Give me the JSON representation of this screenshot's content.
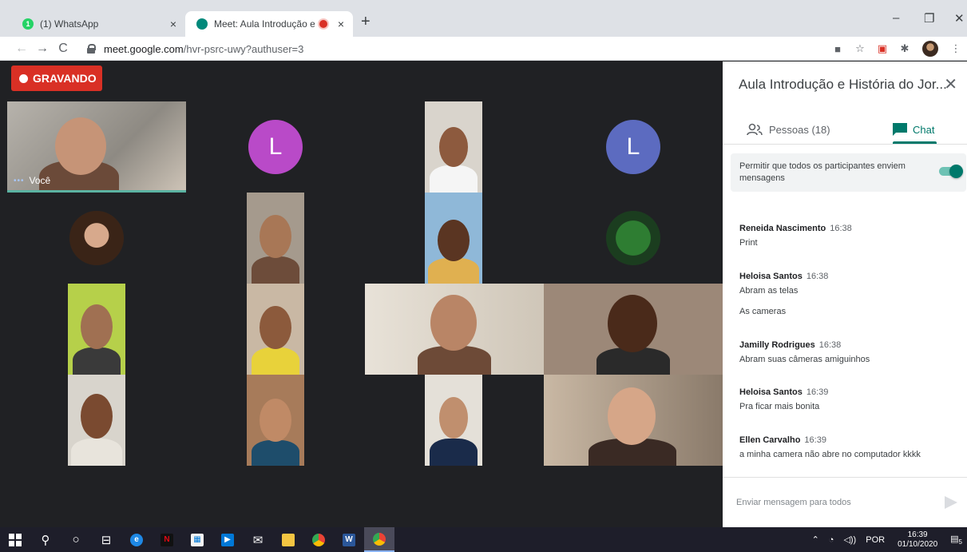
{
  "browser": {
    "tabs": [
      {
        "title": "(1) WhatsApp",
        "favicon": "whatsapp-icon",
        "favicon_color": "#25d366",
        "active": false
      },
      {
        "title": "Meet: Aula Introdução e Hist",
        "favicon": "meet-icon",
        "favicon_color": "#00897b",
        "active": true
      }
    ],
    "new_tab": "+",
    "close_glyph": "×",
    "window_controls": {
      "minimize": "–",
      "restore": "❐",
      "close": "✕"
    },
    "url_host": "meet.google.com",
    "url_path": "/hvr-psrc-uwy?authuser=3"
  },
  "meet": {
    "recording_label": "GRAVANDO",
    "self_label": "Você",
    "avatar_letters": [
      "L",
      "L"
    ],
    "avatar_colors": [
      "#b94ac8",
      "#5c6bc0"
    ]
  },
  "panel": {
    "title": "Aula Introdução e História do Jor...",
    "close": "✕",
    "tab_people": "Pessoas (18)",
    "tab_chat": "Chat",
    "allow_text": "Permitir que todos os participantes enviem mensagens",
    "toggle_on": true,
    "messages": [
      {
        "sender": "Reneida Nascimento",
        "time": "16:38",
        "lines": [
          "Print"
        ]
      },
      {
        "sender": "Heloisa Santos",
        "time": "16:38",
        "lines": [
          "Abram as telas",
          "As cameras"
        ]
      },
      {
        "sender": "Jamilly Rodrigues",
        "time": "16:38",
        "lines": [
          "Abram suas câmeras amiguinhos"
        ]
      },
      {
        "sender": "Heloisa Santos",
        "time": "16:39",
        "lines": [
          "Pra ficar mais bonita"
        ]
      },
      {
        "sender": "Ellen Carvalho",
        "time": "16:39",
        "lines": [
          "a minha camera não abre no computador kkkk"
        ]
      }
    ],
    "compose_placeholder": "Enviar mensagem para todos"
  },
  "taskbar": {
    "language": "POR",
    "time": "16:39",
    "date": "01/10/2020",
    "notification_count": "5"
  }
}
